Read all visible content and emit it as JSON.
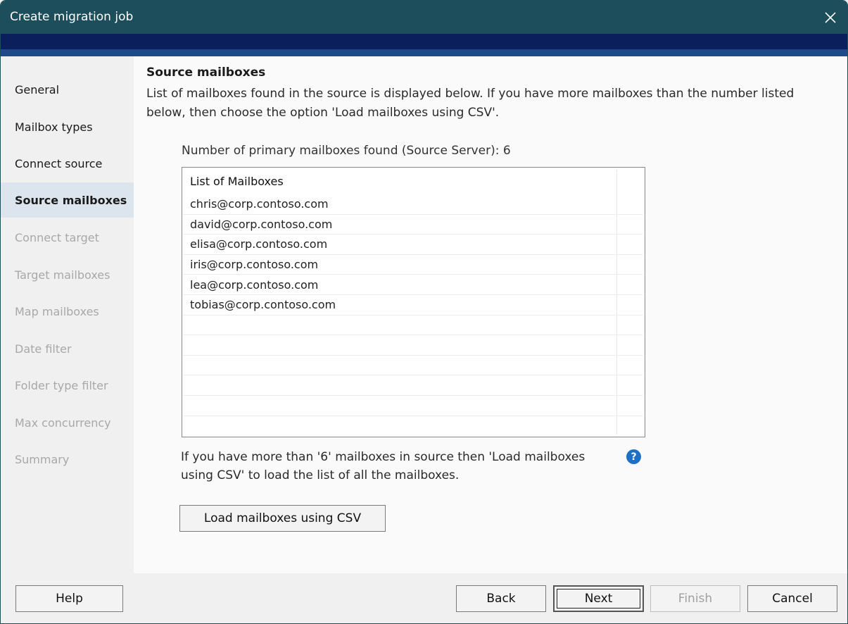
{
  "window": {
    "title": "Create migration job"
  },
  "sidebar": {
    "items": [
      {
        "label": "General",
        "state": "normal"
      },
      {
        "label": "Mailbox types",
        "state": "normal"
      },
      {
        "label": "Connect source",
        "state": "normal"
      },
      {
        "label": "Source mailboxes",
        "state": "active"
      },
      {
        "label": "Connect target",
        "state": "disabled"
      },
      {
        "label": "Target mailboxes",
        "state": "disabled"
      },
      {
        "label": "Map mailboxes",
        "state": "disabled"
      },
      {
        "label": "Date filter",
        "state": "disabled"
      },
      {
        "label": "Folder type filter",
        "state": "disabled"
      },
      {
        "label": "Max concurrency",
        "state": "disabled"
      },
      {
        "label": "Summary",
        "state": "disabled"
      }
    ]
  },
  "main": {
    "heading": "Source mailboxes",
    "description": "List of mailboxes found in the source is displayed below. If you have more mailboxes than the number listed below, then choose the option 'Load mailboxes using CSV'.",
    "count_label": "Number of primary mailboxes found (Source Server): 6",
    "list": {
      "header": "List of Mailboxes",
      "items": [
        "chris@corp.contoso.com",
        "david@corp.contoso.com",
        "elisa@corp.contoso.com",
        "iris@corp.contoso.com",
        "lea@corp.contoso.com",
        "tobias@corp.contoso.com"
      ]
    },
    "note": "If you have more than '6' mailboxes in source then 'Load mailboxes using CSV' to load the list of all the mailboxes.",
    "help_glyph": "?",
    "csv_button": "Load mailboxes using CSV"
  },
  "footer": {
    "help": "Help",
    "back": "Back",
    "next": "Next",
    "finish": "Finish",
    "cancel": "Cancel"
  },
  "colors": {
    "titlebar": "#1c4f5b",
    "band_dark": "#0a1f5c",
    "band_light": "#1f4a8a",
    "active_nav": "#dce4ee",
    "help_icon": "#1f6fc4"
  }
}
